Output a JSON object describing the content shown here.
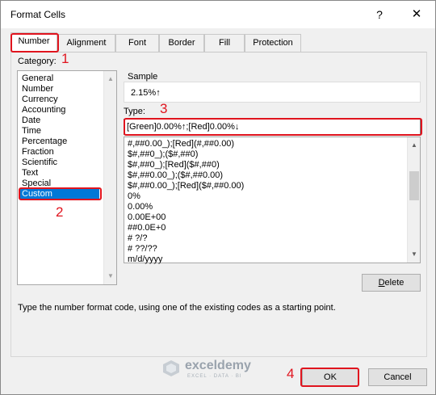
{
  "window": {
    "title": "Format Cells",
    "help_glyph": "?",
    "close_glyph": "✕"
  },
  "tabs": [
    {
      "label": "Number",
      "active": true
    },
    {
      "label": "Alignment",
      "active": false
    },
    {
      "label": "Font",
      "active": false
    },
    {
      "label": "Border",
      "active": false
    },
    {
      "label": "Fill",
      "active": false
    },
    {
      "label": "Protection",
      "active": false
    }
  ],
  "category": {
    "label": "Category:",
    "items": [
      "General",
      "Number",
      "Currency",
      "Accounting",
      "Date",
      "Time",
      "Percentage",
      "Fraction",
      "Scientific",
      "Text",
      "Special",
      "Custom"
    ],
    "selected": "Custom"
  },
  "sample": {
    "label": "Sample",
    "value": "2.15%↑"
  },
  "type": {
    "label": "Type:",
    "value": "[Green]0.00%↑;[Red]0.00%↓"
  },
  "format_codes": [
    "#,##0.00_);[Red](#,##0.00)",
    "$#,##0_);($#,##0)",
    "$#,##0_);[Red]($#,##0)",
    "$#,##0.00_);($#,##0.00)",
    "$#,##0.00_);[Red]($#,##0.00)",
    "0%",
    "0.00%",
    "0.00E+00",
    "##0.0E+0",
    "# ?/?",
    "# ??/??",
    "m/d/yyyy"
  ],
  "buttons": {
    "delete": "Delete",
    "ok": "OK",
    "cancel": "Cancel"
  },
  "description": "Type the number format code, using one of the existing codes as a starting point.",
  "annotations": {
    "a1": "1",
    "a2": "2",
    "a3": "3",
    "a4": "4"
  },
  "watermark": {
    "name": "exceldemy",
    "tagline": "EXCEL · DATA · BI"
  },
  "colors": {
    "annotation_red": "#e0141e",
    "selection_blue": "#0078d7"
  }
}
